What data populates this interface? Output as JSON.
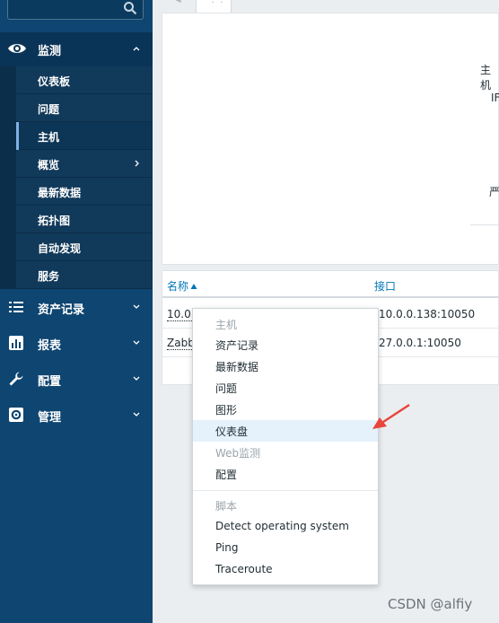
{
  "sidebar": {
    "search_icon": "search-icon",
    "monitoring": {
      "label": "监测",
      "icon": "eye-icon",
      "items": [
        {
          "label": "仪表板"
        },
        {
          "label": "问题"
        },
        {
          "label": "主机",
          "active": true
        },
        {
          "label": "概览",
          "has_submenu": true
        },
        {
          "label": "最新数据"
        },
        {
          "label": "拓扑图"
        },
        {
          "label": "自动发现"
        },
        {
          "label": "服务"
        }
      ]
    },
    "nav": [
      {
        "label": "资产记录",
        "icon": "list-icon"
      },
      {
        "label": "报表",
        "icon": "bar-chart-icon"
      },
      {
        "label": "配置",
        "icon": "wrench-icon"
      },
      {
        "label": "管理",
        "icon": "gear-icon"
      }
    ]
  },
  "top_panel": {
    "labels": [
      "主机",
      "IF",
      "严"
    ]
  },
  "table": {
    "columns": {
      "name": "名称",
      "interface": "接口"
    },
    "rows": [
      {
        "name": "10.0.",
        "interface": "10.0.0.138:10050"
      },
      {
        "name": "Zabb",
        "interface": "27.0.0.1:10050"
      }
    ]
  },
  "context_menu": {
    "host_header": "主机",
    "items": [
      {
        "label": "资产记录"
      },
      {
        "label": "最新数据"
      },
      {
        "label": "问题"
      },
      {
        "label": "图形"
      },
      {
        "label": "仪表盘",
        "highlighted": true
      },
      {
        "label": "Web监测",
        "disabled": true
      },
      {
        "label": "配置"
      }
    ],
    "script_header": "脚本",
    "scripts": [
      {
        "label": "Detect operating system"
      },
      {
        "label": "Ping"
      },
      {
        "label": "Traceroute"
      }
    ]
  },
  "watermark": "CSDN @alfiy",
  "colors": {
    "sidebar": "#0e4571",
    "link": "#0275b8",
    "highlight": "#e5f2fc",
    "arrow": "#e8453c"
  }
}
